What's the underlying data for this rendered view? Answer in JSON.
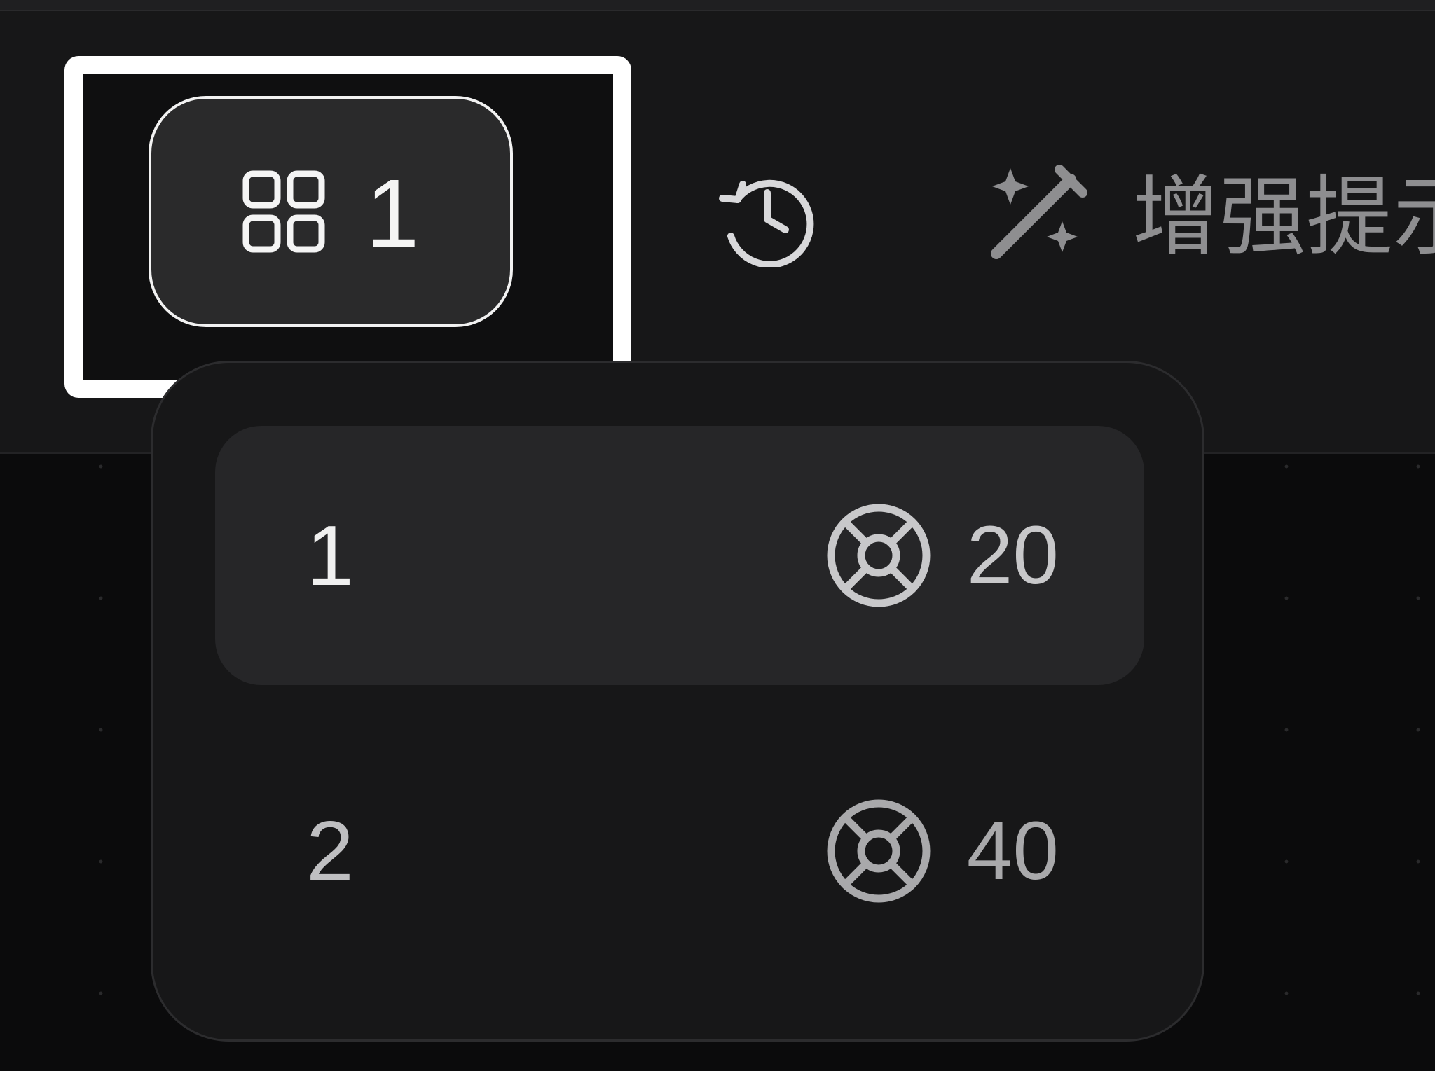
{
  "toolbar": {
    "count_button": {
      "icon": "grid-icon",
      "value": "1"
    },
    "history_button": {
      "icon": "history-icon"
    },
    "enhance_button": {
      "icon": "magic-wand-icon",
      "label": "增强提示"
    }
  },
  "dropdown": {
    "options": [
      {
        "label": "1",
        "cost_icon": "credit-icon",
        "cost": "20",
        "selected": true
      },
      {
        "label": "2",
        "cost_icon": "credit-icon",
        "cost": "40",
        "selected": false
      }
    ]
  },
  "colors": {
    "toolbar_background": "#171718",
    "canvas_background": "#0b0b0c",
    "highlight_frame": "#ffffff",
    "selected_option_background": "#262628",
    "text_primary": "#f0f0f0",
    "text_secondary": "#8e8e90"
  }
}
